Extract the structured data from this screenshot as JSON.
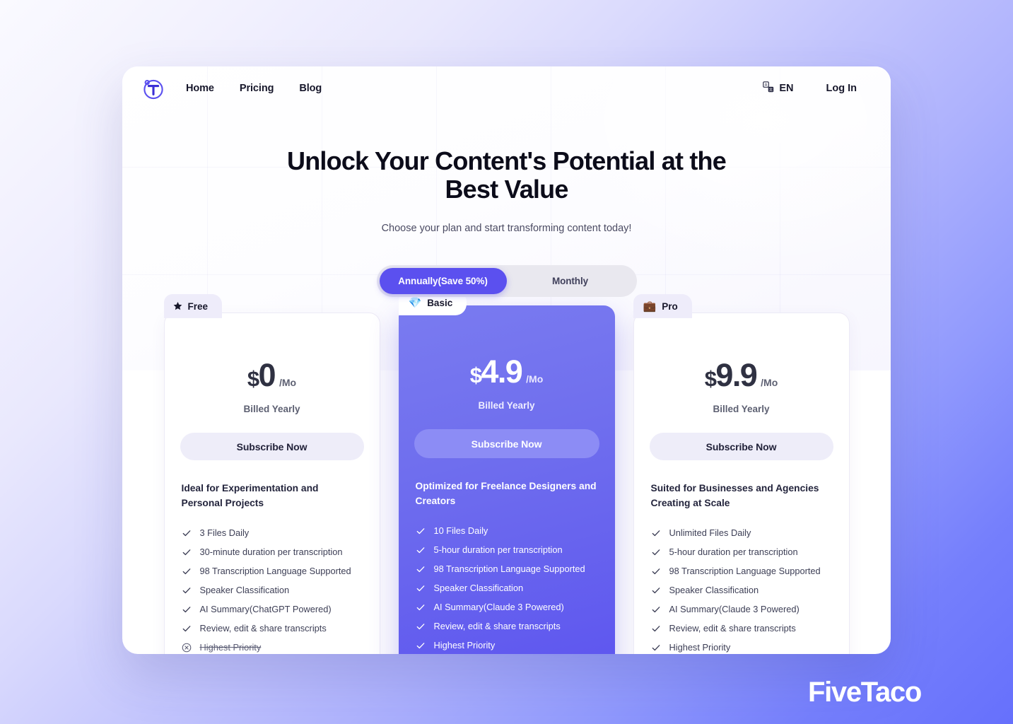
{
  "nav": {
    "logo_icon": "circle-t-logo-icon",
    "links": [
      {
        "label": "Home"
      },
      {
        "label": "Pricing"
      },
      {
        "label": "Blog"
      }
    ],
    "language": {
      "icon": "translate-icon",
      "label": "EN"
    },
    "login_label": "Log In"
  },
  "hero": {
    "title": "Unlock Your Content's Potential at the Best Value",
    "subtitle": "Choose your plan and start transforming content today!"
  },
  "billing_toggle": {
    "options": [
      {
        "label": "Annually(Save 50%)",
        "active": true
      },
      {
        "label": "Monthly",
        "active": false
      }
    ]
  },
  "plans": [
    {
      "name": "Free",
      "badge_icon": "star-badge-icon",
      "badge_glyph": "🟊",
      "featured": false,
      "currency": "$",
      "amount": "0",
      "period": "/Mo",
      "billing_note": "Billed Yearly",
      "cta_label": "Subscribe Now",
      "tagline": "Ideal for Experimentation and Personal Projects",
      "features": [
        {
          "text": "3 Files Daily",
          "included": true
        },
        {
          "text": "30-minute duration per transcription",
          "included": true
        },
        {
          "text": "98 Transcription Language Supported",
          "included": true
        },
        {
          "text": "Speaker Classification",
          "included": true
        },
        {
          "text": "AI Summary(ChatGPT Powered)",
          "included": true
        },
        {
          "text": "Review, edit & share transcripts",
          "included": true
        },
        {
          "text": "Highest Priority",
          "included": false
        }
      ]
    },
    {
      "name": "Basic",
      "badge_icon": "gem-badge-icon",
      "badge_glyph": "💎",
      "featured": true,
      "currency": "$",
      "amount": "4.9",
      "period": "/Mo",
      "billing_note": "Billed Yearly",
      "cta_label": "Subscribe Now",
      "tagline": "Optimized for Freelance Designers and Creators",
      "features": [
        {
          "text": "10 Files Daily",
          "included": true
        },
        {
          "text": "5-hour duration per transcription",
          "included": true
        },
        {
          "text": "98 Transcription Language Supported",
          "included": true
        },
        {
          "text": "Speaker Classification",
          "included": true
        },
        {
          "text": "AI Summary(Claude 3 Powered)",
          "included": true
        },
        {
          "text": "Review, edit & share transcripts",
          "included": true
        },
        {
          "text": "Highest Priority",
          "included": true
        }
      ]
    },
    {
      "name": "Pro",
      "badge_icon": "briefcase-badge-icon",
      "badge_glyph": "💼",
      "featured": false,
      "currency": "$",
      "amount": "9.9",
      "period": "/Mo",
      "billing_note": "Billed Yearly",
      "cta_label": "Subscribe Now",
      "tagline": "Suited for Businesses and Agencies Creating at Scale",
      "features": [
        {
          "text": "Unlimited Files Daily",
          "included": true
        },
        {
          "text": "5-hour duration per transcription",
          "included": true
        },
        {
          "text": "98 Transcription Language Supported",
          "included": true
        },
        {
          "text": "Speaker Classification",
          "included": true
        },
        {
          "text": "AI Summary(Claude 3 Powered)",
          "included": true
        },
        {
          "text": "Review, edit & share transcripts",
          "included": true
        },
        {
          "text": "Highest Priority",
          "included": true
        }
      ]
    }
  ],
  "watermark": {
    "text": "FiveTaco"
  },
  "colors": {
    "accent": "#5b50ef",
    "accent_light": "#8c8cf5",
    "page_gradient_start": "#fafaff",
    "page_gradient_end": "#6670fc",
    "text_dark": "#17172b"
  }
}
